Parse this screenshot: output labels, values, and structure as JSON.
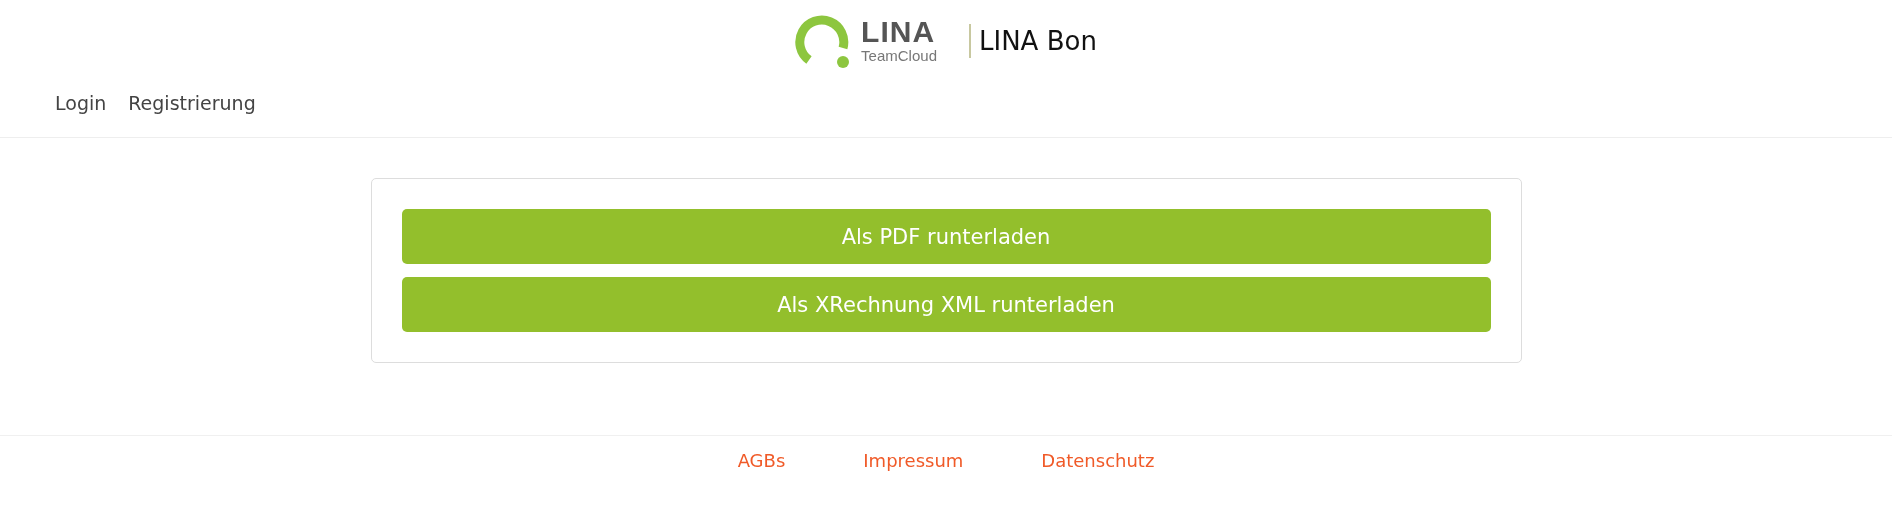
{
  "header": {
    "logo": {
      "name": "LINA",
      "subtitle": "TeamCloud"
    },
    "title": "LINA Bon"
  },
  "nav": [
    {
      "label": "Login"
    },
    {
      "label": "Registrierung"
    }
  ],
  "buttons": [
    {
      "label": "Als PDF runterladen"
    },
    {
      "label": "Als XRechnung XML runterladen"
    }
  ],
  "footer": [
    {
      "label": "AGBs"
    },
    {
      "label": "Impressum"
    },
    {
      "label": "Datenschutz"
    }
  ]
}
